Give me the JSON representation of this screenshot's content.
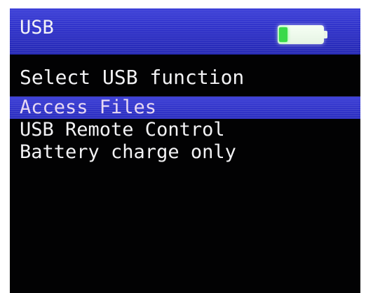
{
  "header": {
    "title": "USB",
    "battery": {
      "icon": "battery-icon",
      "level": 0.2,
      "fill_color": "#39d94a"
    }
  },
  "prompt": "Select USB function",
  "menu": {
    "items": [
      {
        "label": "Access Files",
        "selected": true
      },
      {
        "label": "USB Remote Control",
        "selected": false
      },
      {
        "label": "Battery charge only",
        "selected": false
      }
    ]
  },
  "colors": {
    "highlight": "#2f32c9",
    "background": "#020203",
    "text": "#f2f2f4"
  }
}
